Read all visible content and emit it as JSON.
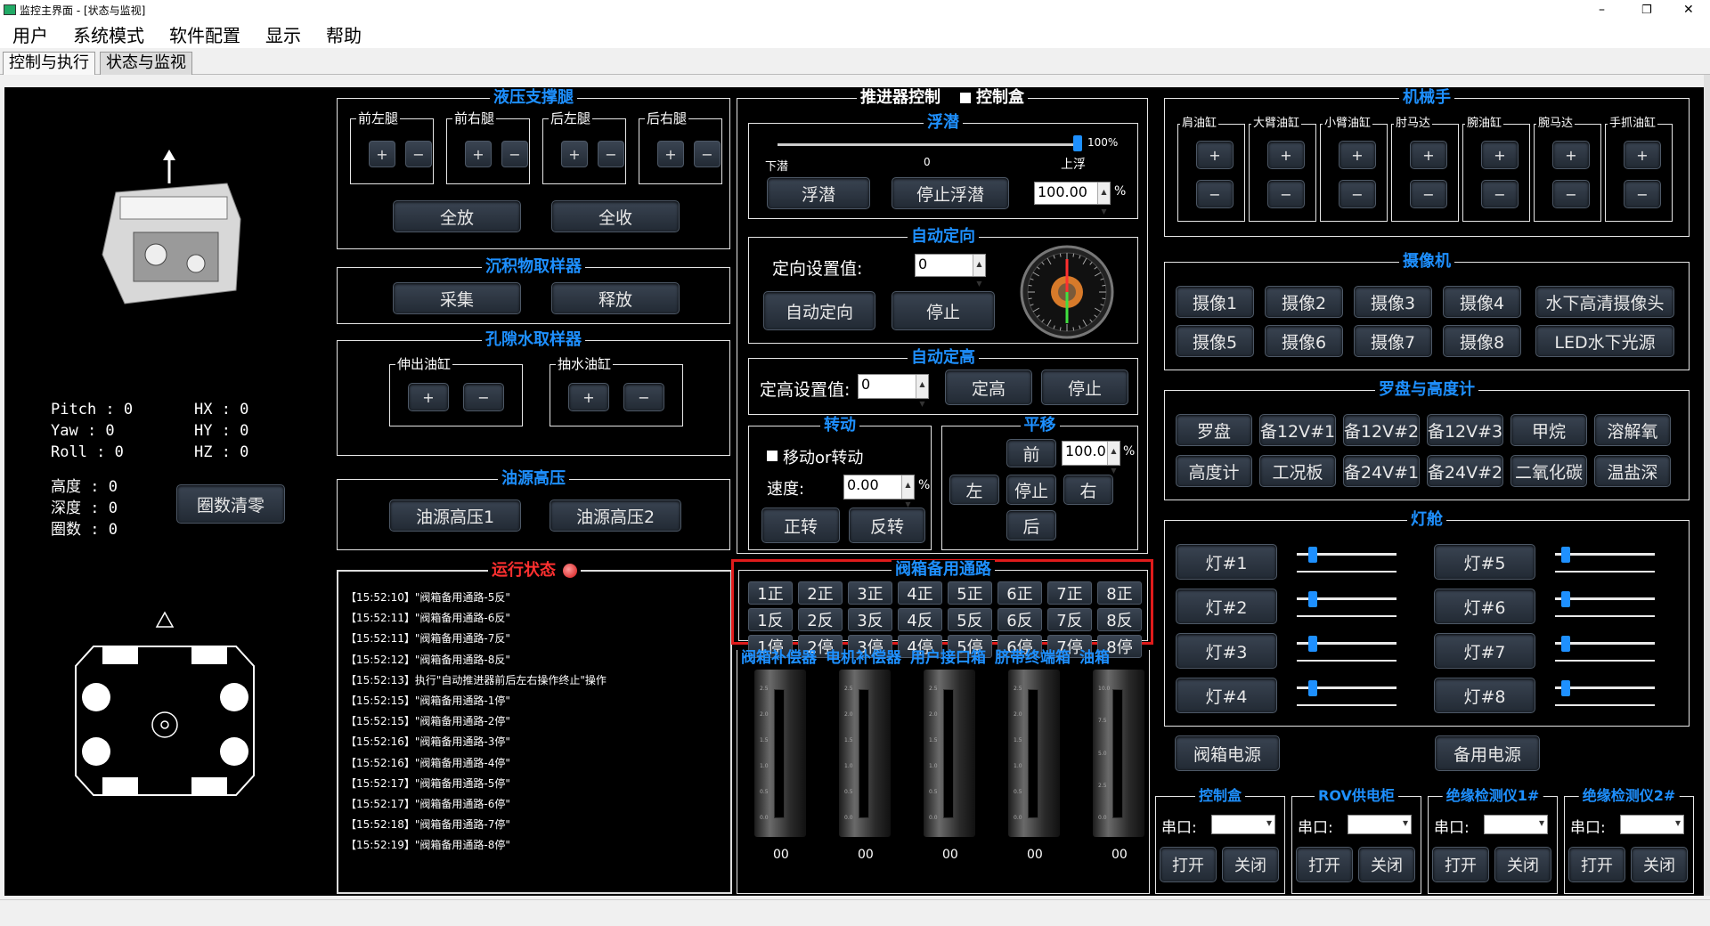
{
  "window": {
    "title": "监控主界面 - [状态与监视]",
    "min": "–",
    "max": "❐",
    "close": "✕"
  },
  "menu": [
    "用户",
    "系统模式",
    "软件配置",
    "显示",
    "帮助"
  ],
  "tabs": [
    "控制与执行",
    "状态与监视"
  ],
  "attitude": {
    "pitch": "Pitch : 0",
    "yaw": "Yaw   : 0",
    "roll": "Roll  : 0",
    "hx": "HX : 0",
    "hy": "HY : 0",
    "hz": "HZ : 0",
    "height": "高度  : 0",
    "depth": "深度  : 0",
    "turns": "圈数  : 0",
    "reset_btn": "圈数清零"
  },
  "hydraulic": {
    "title": "液压支撑腿",
    "legs": [
      "前左腿",
      "前右腿",
      "后左腿",
      "后右腿"
    ],
    "plus": "+",
    "minus": "−",
    "release_all": "全放",
    "retract_all": "全收"
  },
  "sediment": {
    "title": "沉积物取样器",
    "collect": "采集",
    "release": "释放"
  },
  "pore": {
    "title": "孔隙水取样器",
    "cyl1": "伸出油缸",
    "cyl2": "抽水油缸",
    "plus": "+",
    "minus": "−"
  },
  "oil": {
    "title": "油源高压",
    "btn1": "油源高压1",
    "btn2": "油源高压2"
  },
  "runlog": {
    "title": "运行状态",
    "lines": [
      "【15:52:10】\"阀箱备用通路-5反\"",
      "【15:52:11】\"阀箱备用通路-6反\"",
      "【15:52:11】\"阀箱备用通路-7反\"",
      "【15:52:12】\"阀箱备用通路-8反\"",
      "【15:52:13】执行\"自动推进器前后左右操作终止\"操作",
      "【15:52:15】\"阀箱备用通路-1停\"",
      "【15:52:15】\"阀箱备用通路-2停\"",
      "【15:52:16】\"阀箱备用通路-3停\"",
      "【15:52:16】\"阀箱备用通路-4停\"",
      "【15:52:17】\"阀箱备用通路-5停\"",
      "【15:52:17】\"阀箱备用通路-6停\"",
      "【15:52:18】\"阀箱备用通路-7停\"",
      "【15:52:19】\"阀箱备用通路-8停\""
    ]
  },
  "thruster": {
    "title": "推进器控制",
    "checkbox": "控制盒"
  },
  "float": {
    "title": "浮潜",
    "down": "下潜",
    "zero": "0",
    "up": "上浮",
    "pct": "100%",
    "btn_float": "浮潜",
    "btn_stop": "停止浮潜",
    "value": "100.00",
    "unit": "%",
    "level_fraction": 1.0
  },
  "heading": {
    "title": "自动定向",
    "label": "定向设置值:",
    "value": "0",
    "btn_auto": "自动定向",
    "btn_stop": "停止"
  },
  "altitude": {
    "title": "自动定高",
    "label": "定高设置值:",
    "value": "0",
    "btn_set": "定高",
    "btn_stop": "停止"
  },
  "rotate": {
    "title": "转动",
    "check": "移动or转动",
    "speed_label": "速度:",
    "speed": "0.00",
    "unit": "%",
    "cw": "正转",
    "ccw": "反转"
  },
  "translate": {
    "title": "平移",
    "fwd": "前",
    "value": "100.0",
    "unit": "%",
    "left": "左",
    "stop": "停止",
    "right": "右",
    "back": "后"
  },
  "valve": {
    "title": "阀箱备用通路",
    "rows": [
      [
        "1正",
        "2正",
        "3正",
        "4正",
        "5正",
        "6正",
        "7正",
        "8正"
      ],
      [
        "1反",
        "2反",
        "3反",
        "4反",
        "5反",
        "6反",
        "7反",
        "8反"
      ],
      [
        "1停",
        "2停",
        "3停",
        "4停",
        "5停",
        "6停",
        "7停",
        "8停"
      ]
    ]
  },
  "gauges": {
    "labels": [
      "阀箱补偿器",
      "电机补偿器",
      "用户接口箱",
      "脐带终端箱",
      "油箱"
    ],
    "values": [
      "00",
      "00",
      "00",
      "00",
      "00"
    ],
    "ticks_a": [
      "2.5",
      "2.0",
      "1.5",
      "1.0",
      "0.5",
      "0.0"
    ],
    "ticks_b": [
      "10.0",
      "7.5",
      "5.0",
      "2.5",
      "0.0"
    ]
  },
  "mech": {
    "title": "机械手",
    "items": [
      "肩油缸",
      "大臂油缸",
      "小臂油缸",
      "肘马达",
      "腕油缸",
      "腕马达",
      "手抓油缸"
    ],
    "plus": "+",
    "minus": "−"
  },
  "camera": {
    "title": "摄像机",
    "row1": [
      "摄像1",
      "摄像2",
      "摄像3",
      "摄像4",
      "水下高清摄像头"
    ],
    "row2": [
      "摄像5",
      "摄像6",
      "摄像7",
      "摄像8",
      "LED水下光源"
    ]
  },
  "compass": {
    "title": "罗盘与高度计",
    "row1": [
      "罗盘",
      "备12V#1",
      "备12V#2",
      "备12V#3",
      "甲烷",
      "溶解氧"
    ],
    "row2": [
      "高度计",
      "工况板",
      "备24V#1",
      "备24V#2",
      "二氧化碳",
      "温盐深"
    ]
  },
  "lamp": {
    "title": "灯舱",
    "left": [
      "灯#1",
      "灯#2",
      "灯#3",
      "灯#4"
    ],
    "right": [
      "灯#5",
      "灯#6",
      "灯#7",
      "灯#8"
    ],
    "valve_power": "阀箱电源",
    "spare_power": "备用电源",
    "levels": [
      0.12,
      0.12,
      0.12,
      0.12,
      0.06,
      0.06,
      0.06,
      0.06
    ]
  },
  "serial": [
    {
      "title": "控制盒",
      "port": "串口:",
      "open": "打开",
      "close": "关闭"
    },
    {
      "title": "ROV供电柜",
      "port": "串口:",
      "open": "打开",
      "close": "关闭"
    },
    {
      "title": "绝缘检测仪1#",
      "port": "串口:",
      "open": "打开",
      "close": "关闭"
    },
    {
      "title": "绝缘检测仪2#",
      "port": "串口:",
      "open": "打开",
      "close": "关闭"
    }
  ],
  "colors": {
    "title_blue": "#1e90ff",
    "highlight_red": "#e01b1b",
    "panel_bg": "#000000"
  }
}
